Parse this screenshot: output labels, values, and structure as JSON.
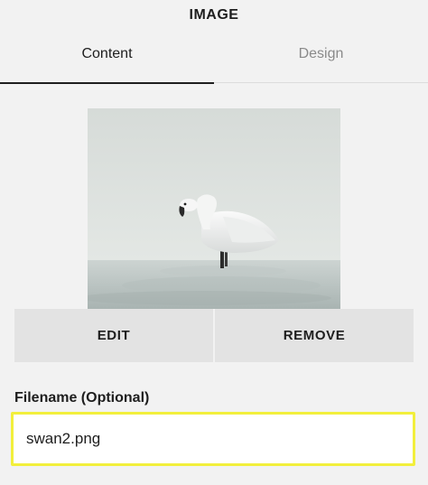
{
  "panel": {
    "title": "IMAGE"
  },
  "tabs": [
    {
      "label": "Content",
      "active": true
    },
    {
      "label": "Design",
      "active": false
    }
  ],
  "image": {
    "description_icon": "swan-photo"
  },
  "actions": {
    "edit_label": "EDIT",
    "remove_label": "REMOVE"
  },
  "filename": {
    "label": "Filename (Optional)",
    "value": "swan2.png",
    "highlight_color": "#f2ef3c"
  }
}
